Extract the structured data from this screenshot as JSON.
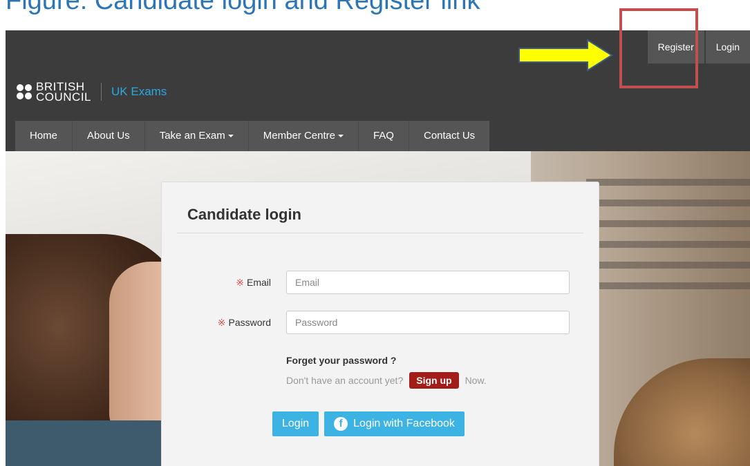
{
  "doc": {
    "heading": "Figure: Candidate login and Register link"
  },
  "top_links": {
    "register": "Register",
    "login": "Login"
  },
  "brand": {
    "line1": "BRITISH",
    "line2": "COUNCIL",
    "name": "UK Exams"
  },
  "nav": {
    "items": [
      {
        "label": "Home",
        "dropdown": false
      },
      {
        "label": "About Us",
        "dropdown": false
      },
      {
        "label": "Take an Exam",
        "dropdown": true
      },
      {
        "label": "Member Centre",
        "dropdown": true
      },
      {
        "label": "FAQ",
        "dropdown": false
      },
      {
        "label": "Contact Us",
        "dropdown": false
      }
    ]
  },
  "login_card": {
    "title": "Candidate login",
    "required_mark": "※",
    "email_label": "Email",
    "email_placeholder": "Email",
    "password_label": "Password",
    "password_placeholder": "Password",
    "forgot": "Forget your password ?",
    "no_account": "Don't have an account yet?",
    "signup": "Sign up",
    "now": "Now.",
    "login_button": "Login",
    "facebook_button": "Login with Facebook"
  },
  "colors": {
    "accent": "#29a9e1",
    "button": "#3cb3e3",
    "signup": "#a31d18",
    "header": "#3c3c3c",
    "annotation_box": "#c0504d",
    "annotation_arrow": "#ffff00"
  }
}
